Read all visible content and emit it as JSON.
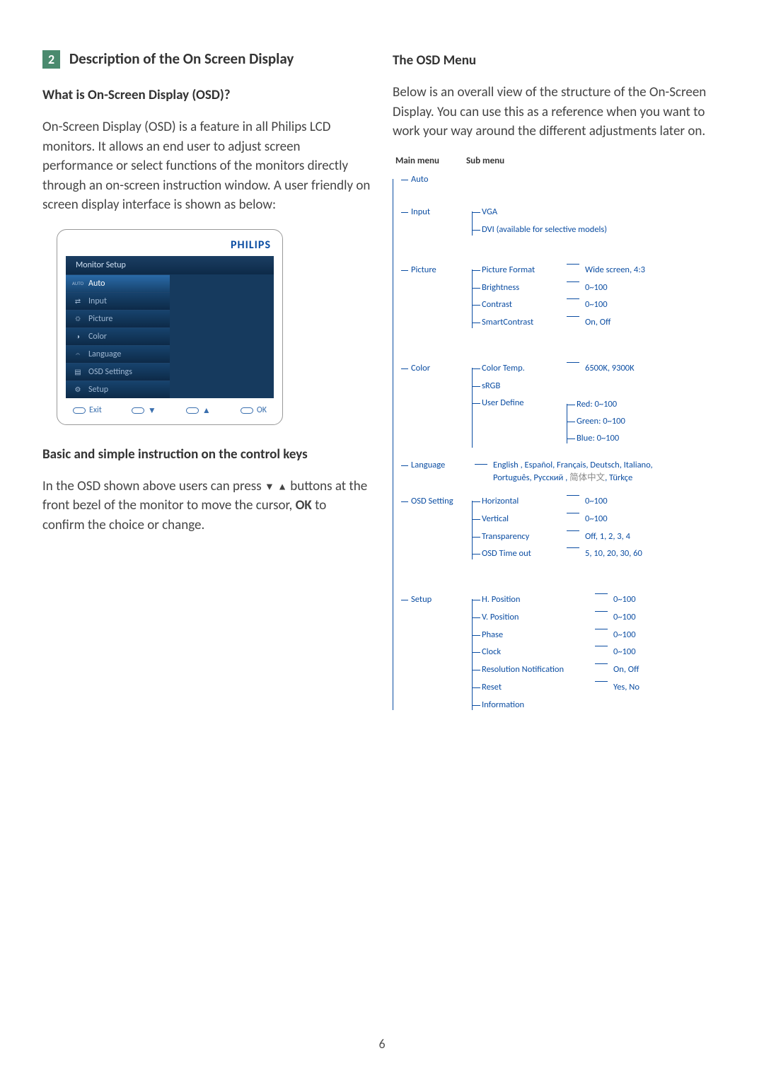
{
  "section": {
    "number": "2",
    "title": "Description of the On Screen Display",
    "q": "What is On-Screen Display (OSD)?",
    "intro": "On-Screen Display (OSD) is a feature in all Philips LCD monitors. It allows an end user to adjust screen performance or select functions of the monitors directly through an on-screen instruction window. A user friendly on screen display interface is shown as below:",
    "basic_h": "Basic and simple instruction on the control keys",
    "basic_p1": "In the OSD shown above users can press ",
    "basic_p2": " buttons at the front bezel of the monitor to move the cursor, ",
    "basic_ok": "OK",
    "basic_p3": " to confirm the choice or change."
  },
  "osd": {
    "brand": "PHILIPS",
    "title": "Monitor Setup",
    "items": [
      {
        "icon": "AUTO",
        "label": "Auto",
        "selected": true
      },
      {
        "icon": "⇄",
        "label": "Input"
      },
      {
        "icon": "☼",
        "label": "Picture"
      },
      {
        "icon": "◑",
        "label": "Color"
      },
      {
        "icon": "𝄐",
        "label": "Language"
      },
      {
        "icon": "▤",
        "label": "OSD Settings"
      },
      {
        "icon": "⚙",
        "label": "Setup"
      }
    ],
    "footer": {
      "exit": "Exit",
      "ok": "OK"
    }
  },
  "right": {
    "h": "The OSD Menu",
    "p": "Below is an overall view of the structure of the On-Screen Display. You can use this as a reference when you want to work your way around the different adjustments later on.",
    "headers": {
      "main": "Main menu",
      "sub": "Sub menu"
    }
  },
  "tree": {
    "auto": "Auto",
    "input": {
      "label": "Input",
      "items": [
        {
          "label": "VGA"
        },
        {
          "label": "DVI (available for selective models)"
        }
      ]
    },
    "picture": {
      "label": "Picture",
      "items": [
        {
          "label": "Picture Format",
          "val": "Wide screen, 4:3"
        },
        {
          "label": "Brightness",
          "val": "0~100"
        },
        {
          "label": "Contrast",
          "val": "0~100"
        },
        {
          "label": "SmartContrast",
          "val": "On, Off"
        }
      ]
    },
    "color": {
      "label": "Color",
      "items": [
        {
          "label": "Color Temp.",
          "val": "6500K, 9300K"
        },
        {
          "label": "sRGB"
        },
        {
          "label": "User Define",
          "nested": [
            "Red: 0~100",
            "Green: 0~100",
            "Blue: 0~100"
          ]
        }
      ]
    },
    "language": {
      "label": "Language",
      "line1": "English , Español, Français, Deutsch, Italiano,",
      "line2a": "Português, Русский , ",
      "line2cn": "简体中文",
      "line2b": ", Türkçe"
    },
    "osdsetting": {
      "label": "OSD Setting",
      "items": [
        {
          "label": "Horizontal",
          "val": "0~100"
        },
        {
          "label": "Vertical",
          "val": "0~100"
        },
        {
          "label": "Transparency",
          "val": "Off, 1, 2, 3, 4"
        },
        {
          "label": "OSD Time out",
          "val": "5, 10, 20, 30, 60"
        }
      ]
    },
    "setup": {
      "label": "Setup",
      "items": [
        {
          "label": "H. Position",
          "val": "0~100"
        },
        {
          "label": "V. Position",
          "val": "0~100"
        },
        {
          "label": "Phase",
          "val": "0~100"
        },
        {
          "label": "Clock",
          "val": "0~100"
        },
        {
          "label": "Resolution Notification",
          "val": "On, Off"
        },
        {
          "label": "Reset",
          "val": "Yes, No"
        },
        {
          "label": "Information"
        }
      ]
    }
  },
  "page": "6"
}
